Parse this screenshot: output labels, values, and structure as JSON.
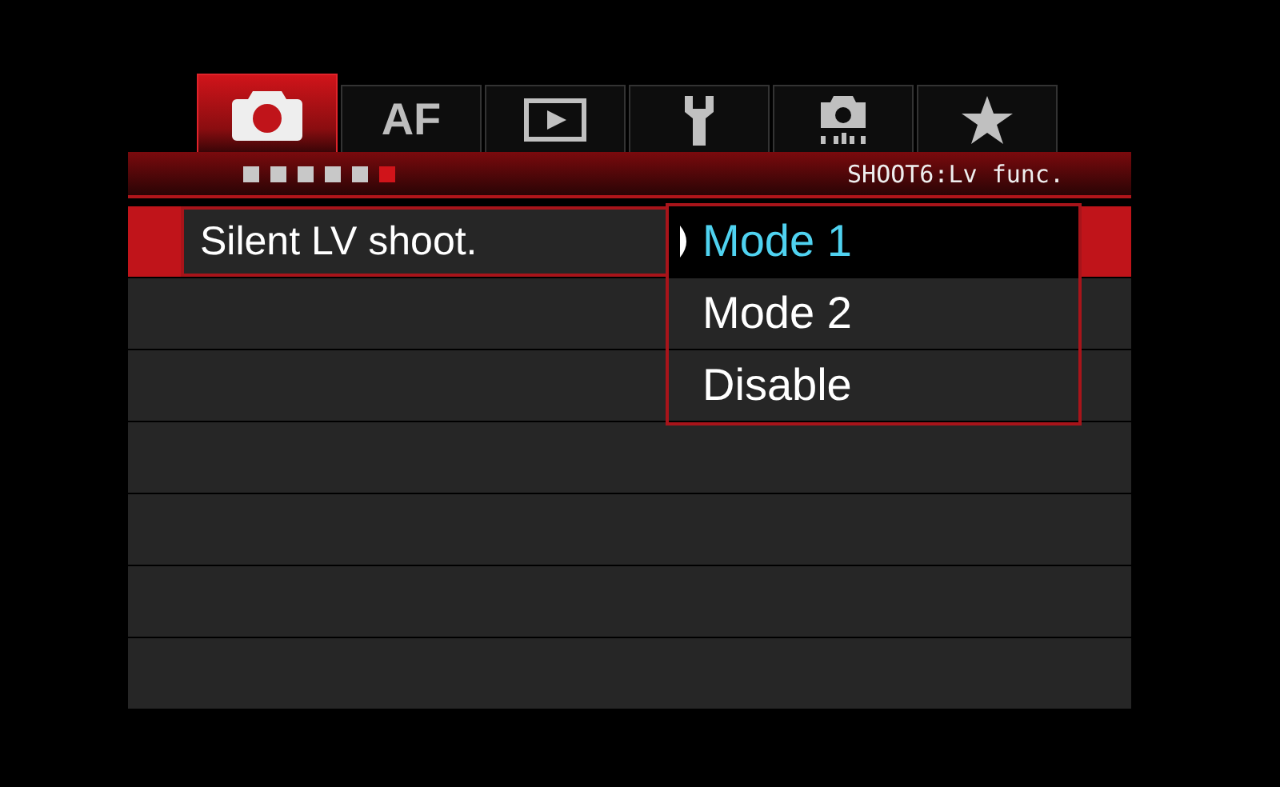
{
  "tabs": [
    {
      "kind": "camera",
      "selected": true
    },
    {
      "kind": "text",
      "label": "AF",
      "selected": false
    },
    {
      "kind": "play",
      "selected": false
    },
    {
      "kind": "wrench",
      "selected": false
    },
    {
      "kind": "camera-dots",
      "selected": false
    },
    {
      "kind": "star",
      "selected": false
    }
  ],
  "pages": [
    {
      "selected": false
    },
    {
      "selected": false
    },
    {
      "selected": false
    },
    {
      "selected": false
    },
    {
      "selected": false
    },
    {
      "selected": true
    }
  ],
  "menu_title": "SHOOT6:Lv func.",
  "rows": [
    {
      "label": "Silent LV shoot.",
      "selected": true
    },
    {
      "selected": false
    },
    {
      "selected": false
    },
    {
      "selected": false
    },
    {
      "selected": false
    },
    {
      "selected": false
    },
    {
      "selected": false
    }
  ],
  "options": [
    {
      "label": "Mode 1",
      "selected": true
    },
    {
      "label": "Mode 2",
      "selected": false
    },
    {
      "label": "Disable",
      "selected": false
    }
  ]
}
